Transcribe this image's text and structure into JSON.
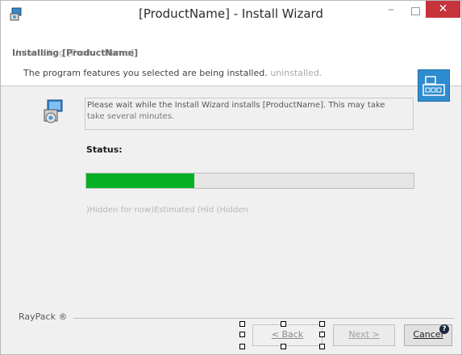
{
  "window": {
    "title": "[ProductName] - Install Wizard",
    "minimize_glyph": "–",
    "close_glyph": "✕"
  },
  "header": {
    "title": "Installing [ProductName]",
    "title_overlap": "Uninstalling [ProductName]",
    "description": "The program features you selected are being installed.",
    "description_overlap": "uninstalled."
  },
  "content": {
    "wait_line1": "Please wait while the Install Wizard installs [ProductName]. This may take",
    "wait_line2": "take several minutes.",
    "status_label": "Status:",
    "progress_fraction": 0.33,
    "hidden_text": ")Hidden for now)Estimated    (Hid  (Hidden"
  },
  "footer": {
    "brand": "RayPack ®",
    "back_label": "< Back",
    "next_label": "Next >",
    "cancel_label": "Cancel",
    "help_glyph": "?"
  }
}
